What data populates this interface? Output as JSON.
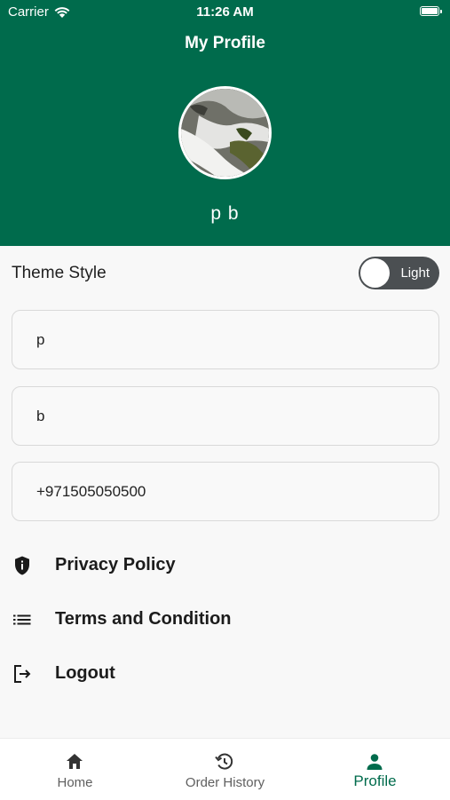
{
  "status_bar": {
    "carrier": "Carrier",
    "time": "11:26 AM"
  },
  "header": {
    "title": "My Profile",
    "name": "p b",
    "background_color": "#006b4c"
  },
  "theme": {
    "label": "Theme Style",
    "toggle_text": "Light",
    "enabled": false
  },
  "fields": {
    "first_name": "p",
    "last_name": "b",
    "phone": "+971505050500"
  },
  "menu": {
    "privacy": {
      "label": "Privacy Policy",
      "icon": "shield-icon"
    },
    "terms": {
      "label": "Terms and Condition",
      "icon": "list-icon"
    },
    "logout": {
      "label": "Logout",
      "icon": "logout-icon"
    }
  },
  "bottom_nav": {
    "home": {
      "label": "Home",
      "icon": "home-icon"
    },
    "orders": {
      "label": "Order History",
      "icon": "history-icon"
    },
    "profile": {
      "label": "Profile",
      "icon": "person-icon",
      "active": true
    },
    "active_color": "#006b4c"
  }
}
